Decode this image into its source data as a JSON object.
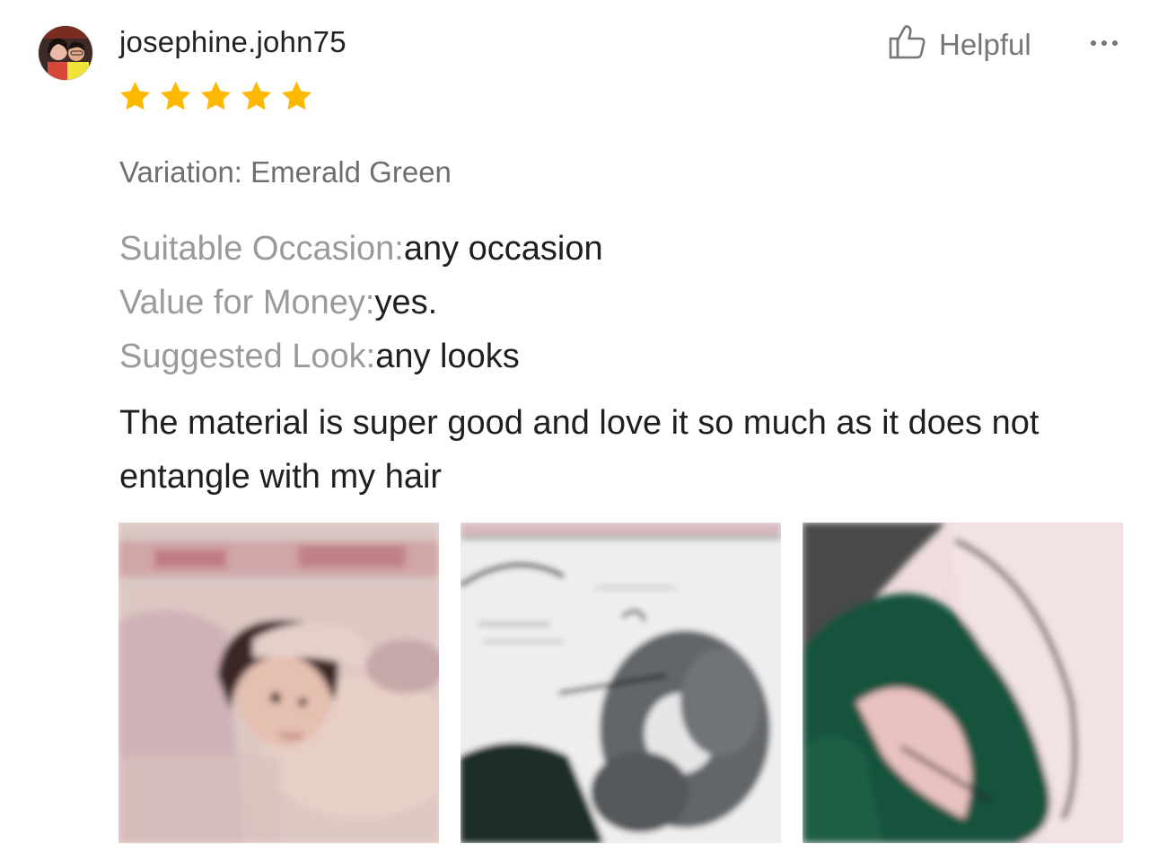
{
  "review": {
    "username": "josephine.john75",
    "rating": 5,
    "rating_max": 5,
    "helpful_label": "Helpful",
    "variation": "Variation: Emerald Green",
    "attributes": [
      {
        "key": "Suitable Occasion:",
        "value": "any occasion"
      },
      {
        "key": "Value for Money:",
        "value": "yes."
      },
      {
        "key": "Suggested Look:",
        "value": "any looks"
      }
    ],
    "text": "The material is super good and love it so much as it does not entangle with my hair",
    "photos": [
      "photo-woman-eye-mask",
      "photo-grey-scrunchie",
      "photo-green-scrunchie"
    ]
  },
  "icons": {
    "star": "star-icon",
    "helpful": "thumbs-up-icon",
    "more": "more-horizontal-icon"
  },
  "colors": {
    "star": "#FFB800",
    "muted_text": "#9A9A9A",
    "main_text": "#1F1F1F"
  }
}
